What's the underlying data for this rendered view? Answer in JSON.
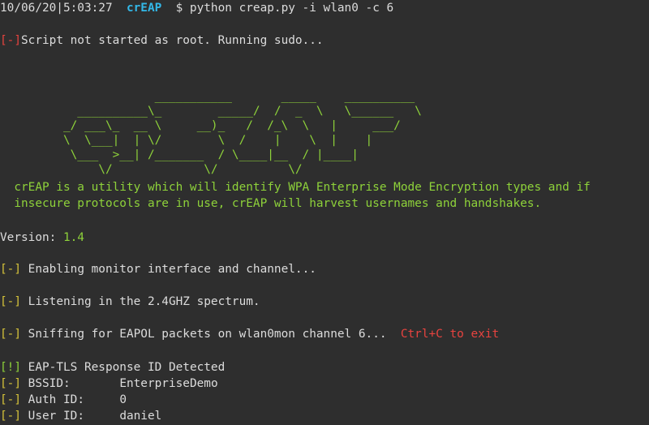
{
  "prompt": {
    "datetime": "10/06/20|5:03:27",
    "app": "crEAP",
    "command": "$ python creap.py -i wlan0 -c 6"
  },
  "colors": {
    "background": "#2e2e2e",
    "text": "#dcdcdc",
    "accent_blue": "#33b8e8",
    "warn_red": "#e8433f",
    "info_yellow": "#d6c43a",
    "highlight_green": "#8ed23a"
  },
  "warning": {
    "tag": "[-]",
    "text": "Script not started as root. Running sudo..."
  },
  "banner_art": "                      ___________       _____    __________\n           __________\\_        _____/  /  _  \\   \\______   \\\n         _/ ___\\_  __ \\     __)_   /  /_\\  \\   |     ___/\n         \\  \\___|  | \\/        \\  /    |    \\  |    |\n          \\___  >__| /_______  / \\____|__  / |____|\n              \\/             \\/          \\/",
  "description": {
    "line1": "  crEAP is a utility which will identify WPA Enterprise Mode Encryption types and if",
    "line2": "  insecure protocols are in use, crEAP will harvest usernames and handshakes."
  },
  "version": {
    "label": "Version: ",
    "value": "1.4"
  },
  "status": {
    "monitor": {
      "tag": "[-]",
      "text": "Enabling monitor interface and channel..."
    },
    "listening": {
      "tag": "[-]",
      "text": "Listening in the 2.4GHZ spectrum."
    },
    "sniffing": {
      "tag": "[-]",
      "text": "Sniffing for EAPOL packets on wlan0mon channel 6...  ",
      "hint": "Ctrl+C to exit"
    }
  },
  "detection": {
    "header": {
      "tag": "[!]",
      "text": "EAP-TLS Response ID Detected"
    },
    "bssid": {
      "tag": "[-]",
      "label": "BSSID:       ",
      "value": "EnterpriseDemo"
    },
    "auth_id": {
      "tag": "[-]",
      "label": "Auth ID:     ",
      "value": "0"
    },
    "user_id": {
      "tag": "[-]",
      "label": "User ID:     ",
      "value": "daniel"
    }
  }
}
